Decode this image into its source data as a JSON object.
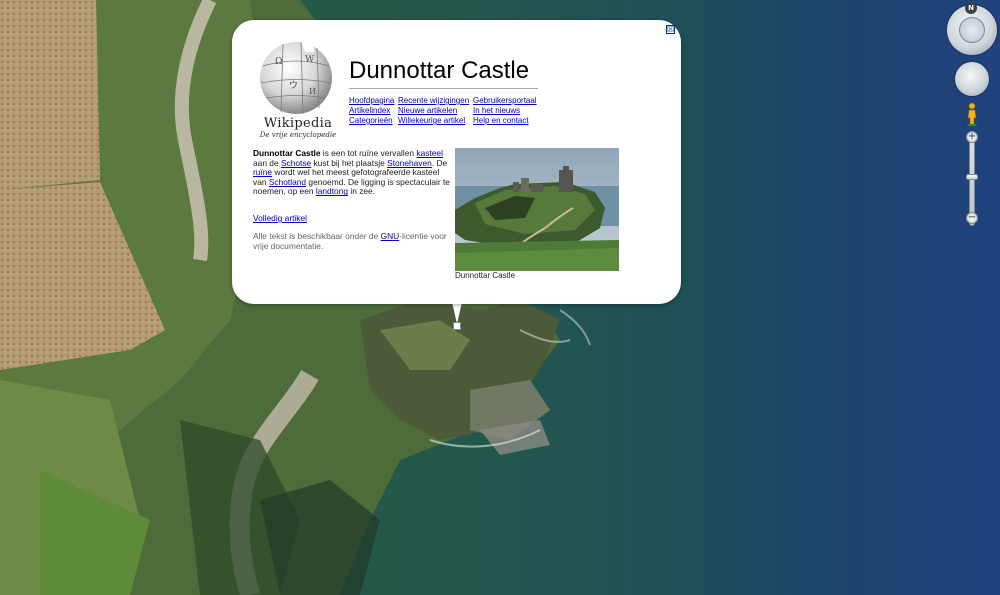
{
  "balloon": {
    "title": "Dunnottar Castle",
    "close_glyph": "☒",
    "logo": {
      "wordmark": "Wikipedia",
      "tagline": "De vrije encyclopedie"
    },
    "nav_links": [
      [
        "Hoofdpagina",
        "Recente wijzigingen",
        "Gebruikersportaal"
      ],
      [
        "Artikelindex",
        "Nieuwe artikelen",
        "In het nieuws"
      ],
      [
        "Categorieën",
        "Willekeurige artikel",
        "Help en contact"
      ]
    ],
    "description": {
      "bold": "Dunnottar Castle",
      "t1": " is een tot ruïne vervallen ",
      "l1": "kasteel",
      "t2": " aan de ",
      "l2": "Schotse",
      "t3": " kust bij het plaatsje ",
      "l3": "Stonehaven",
      "t4": ". De ",
      "l4": "ruïne",
      "t5": " wordt wel het meest gefotografeerde kasteel van ",
      "l5": "Schotland",
      "t6": " genoemd. De ligging is spectaculair te noemen, op een ",
      "l6": "landtong",
      "t7": " in zee."
    },
    "more_link": "Volledig artikel",
    "license": {
      "t1": "Alle tekst is beschikbaar onder de ",
      "link": "GNU",
      "t2": "-licentie voor vrije documentatie."
    },
    "photo_caption": "Dunnottar Castle"
  },
  "controls": {
    "north_label": "N",
    "zoom_in": "+",
    "zoom_out": "−"
  },
  "colors": {
    "sea": "#1f4f3e",
    "deep_sea": "#1c3f7a",
    "link": "#0000cc"
  }
}
